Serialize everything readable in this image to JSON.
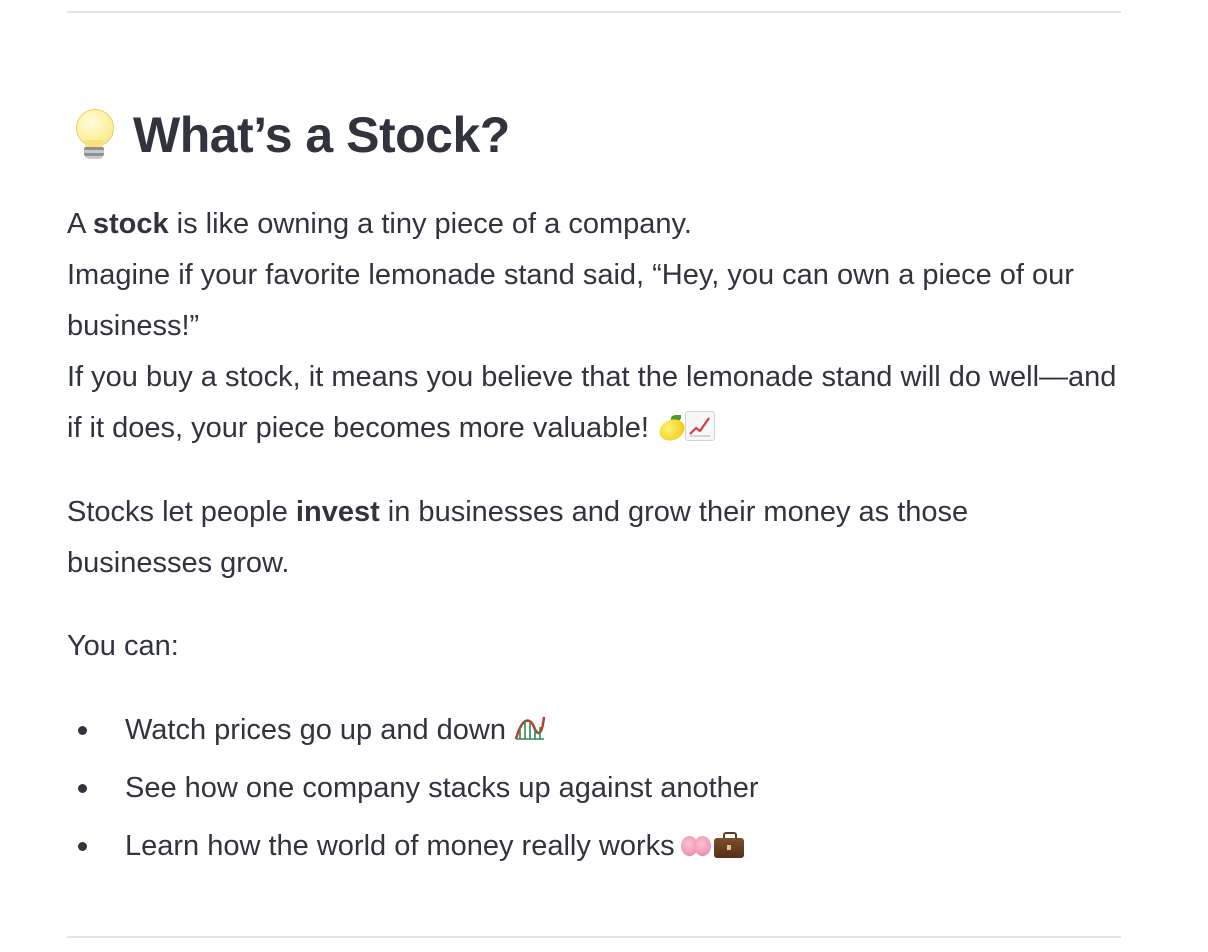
{
  "section": {
    "heading": "What’s a Stock?",
    "heading_icon": "lightbulb-icon",
    "intro": {
      "line1_prefix": "A ",
      "line1_bold": "stock",
      "line1_suffix": " is like owning a tiny piece of a company.",
      "line2": "Imagine if your favorite lemonade stand said, “Hey, you can own a piece of our business!”",
      "line3": "If you buy a stock, it means you believe that the lemonade stand will do well—and if it does, your piece becomes more valuable!",
      "line3_icons": [
        "lemon-icon",
        "chart-increasing-icon"
      ]
    },
    "invest": {
      "prefix": "Stocks let people ",
      "bold": "invest",
      "suffix": " in businesses and grow their money as those businesses grow."
    },
    "you_can": "You can:",
    "list": [
      {
        "text": "Watch prices go up and down",
        "icons": [
          "roller-coaster-icon"
        ]
      },
      {
        "text": "See how one company stacks up against another",
        "icons": []
      },
      {
        "text": "Learn how the world of money really works",
        "icons": [
          "brain-icon",
          "briefcase-icon"
        ]
      }
    ]
  },
  "colors": {
    "text": "#31333f",
    "divider": "#e4e4e6",
    "background": "#ffffff"
  }
}
